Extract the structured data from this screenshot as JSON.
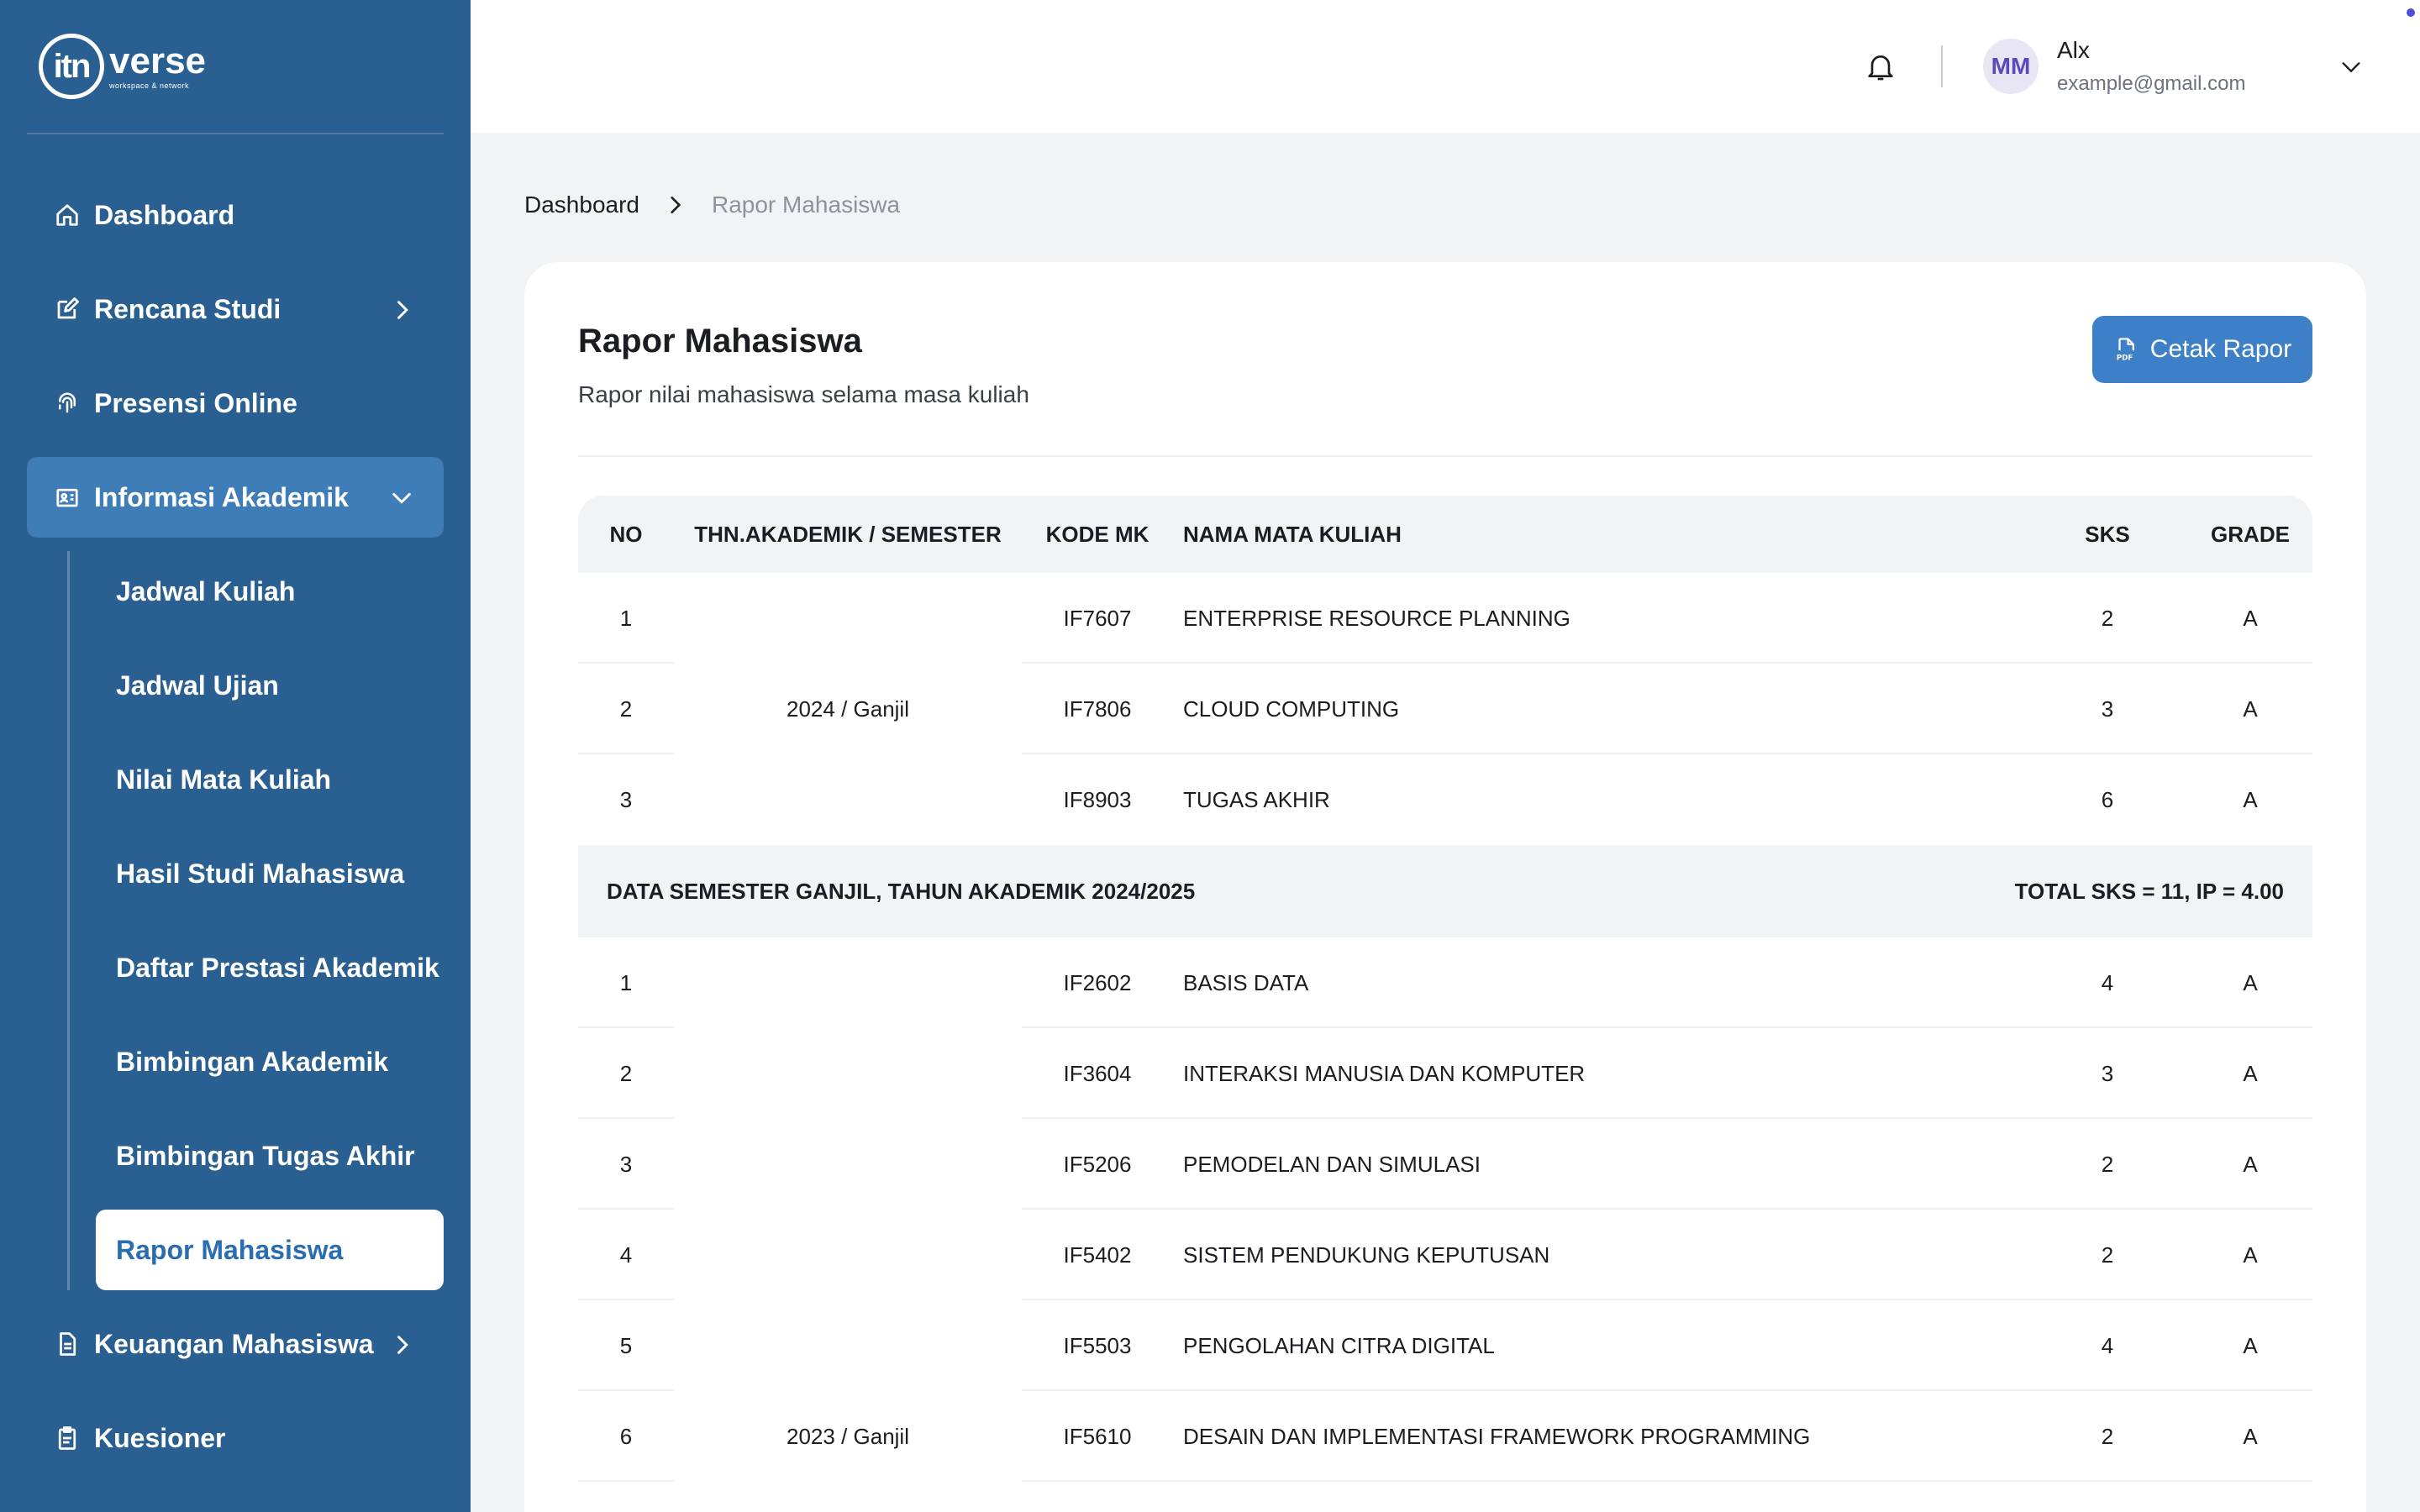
{
  "brand": {
    "logo_mark": "itn",
    "name": "verse",
    "tagline": "workspace & network"
  },
  "sidebar": {
    "items": [
      {
        "label": "Dashboard",
        "icon": "home-icon"
      },
      {
        "label": "Rencana Studi",
        "icon": "edit-icon",
        "has_children": true
      },
      {
        "label": "Presensi Online",
        "icon": "fingerprint-icon"
      },
      {
        "label": "Informasi Akademik",
        "icon": "id-card-icon",
        "expanded": true,
        "active": true
      },
      {
        "label": "Keuangan Mahasiswa",
        "icon": "document-icon",
        "has_children": true
      },
      {
        "label": "Kuesioner",
        "icon": "clipboard-icon"
      }
    ],
    "sub_items": [
      {
        "label": "Jadwal Kuliah"
      },
      {
        "label": "Jadwal Ujian"
      },
      {
        "label": "Nilai Mata Kuliah"
      },
      {
        "label": "Hasil Studi Mahasiswa"
      },
      {
        "label": "Daftar Prestasi Akademik"
      },
      {
        "label": "Bimbingan Akademik"
      },
      {
        "label": "Bimbingan Tugas Akhir"
      },
      {
        "label": "Rapor Mahasiswa",
        "current": true
      }
    ]
  },
  "header": {
    "user": {
      "initials": "MM",
      "name": "Alx",
      "email": "example@gmail.com"
    }
  },
  "breadcrumb": {
    "home": "Dashboard",
    "current": "Rapor Mahasiswa"
  },
  "card": {
    "title": "Rapor Mahasiswa",
    "subtitle": "Rapor nilai mahasiswa selama masa kuliah",
    "print_label": "Cetak Rapor"
  },
  "table": {
    "headers": {
      "no": "NO",
      "semester": "THN.AKADEMIK / SEMESTER",
      "kode": "KODE MK",
      "nama": "NAMA MATA KULIAH",
      "sks": "SKS",
      "grade": "GRADE"
    },
    "groups": [
      {
        "semester": "2024 / Ganjil",
        "rows": [
          {
            "no": "1",
            "kode": "IF7607",
            "nama": "ENTERPRISE RESOURCE PLANNING",
            "sks": "2",
            "grade": "A"
          },
          {
            "no": "2",
            "kode": "IF7806",
            "nama": "CLOUD COMPUTING",
            "sks": "3",
            "grade": "A"
          },
          {
            "no": "3",
            "kode": "IF8903",
            "nama": "TUGAS AKHIR",
            "sks": "6",
            "grade": "A"
          }
        ],
        "summary_left": "DATA SEMESTER GANJIL, TAHUN AKADEMIK 2024/2025",
        "summary_right": "TOTAL SKS = 11, IP = 4.00"
      },
      {
        "semester": "2023 / Ganjil",
        "rows": [
          {
            "no": "1",
            "kode": "IF2602",
            "nama": "BASIS DATA",
            "sks": "4",
            "grade": "A"
          },
          {
            "no": "2",
            "kode": "IF3604",
            "nama": "INTERAKSI MANUSIA DAN KOMPUTER",
            "sks": "3",
            "grade": "A"
          },
          {
            "no": "3",
            "kode": "IF5206",
            "nama": "PEMODELAN DAN SIMULASI",
            "sks": "2",
            "grade": "A"
          },
          {
            "no": "4",
            "kode": "IF5402",
            "nama": "SISTEM PENDUKUNG KEPUTUSAN",
            "sks": "2",
            "grade": "A"
          },
          {
            "no": "5",
            "kode": "IF5503",
            "nama": "PENGOLAHAN CITRA DIGITAL",
            "sks": "4",
            "grade": "A"
          },
          {
            "no": "6",
            "kode": "IF5610",
            "nama": "DESAIN DAN IMPLEMENTASI FRAMEWORK PROGRAMMING",
            "sks": "2",
            "grade": "A"
          }
        ]
      }
    ]
  },
  "colors": {
    "sidebar": "#2A5F91",
    "sidebar_active": "#3F7DB8",
    "primary_button": "#3D80C7",
    "current_text": "#2A6DB0"
  }
}
